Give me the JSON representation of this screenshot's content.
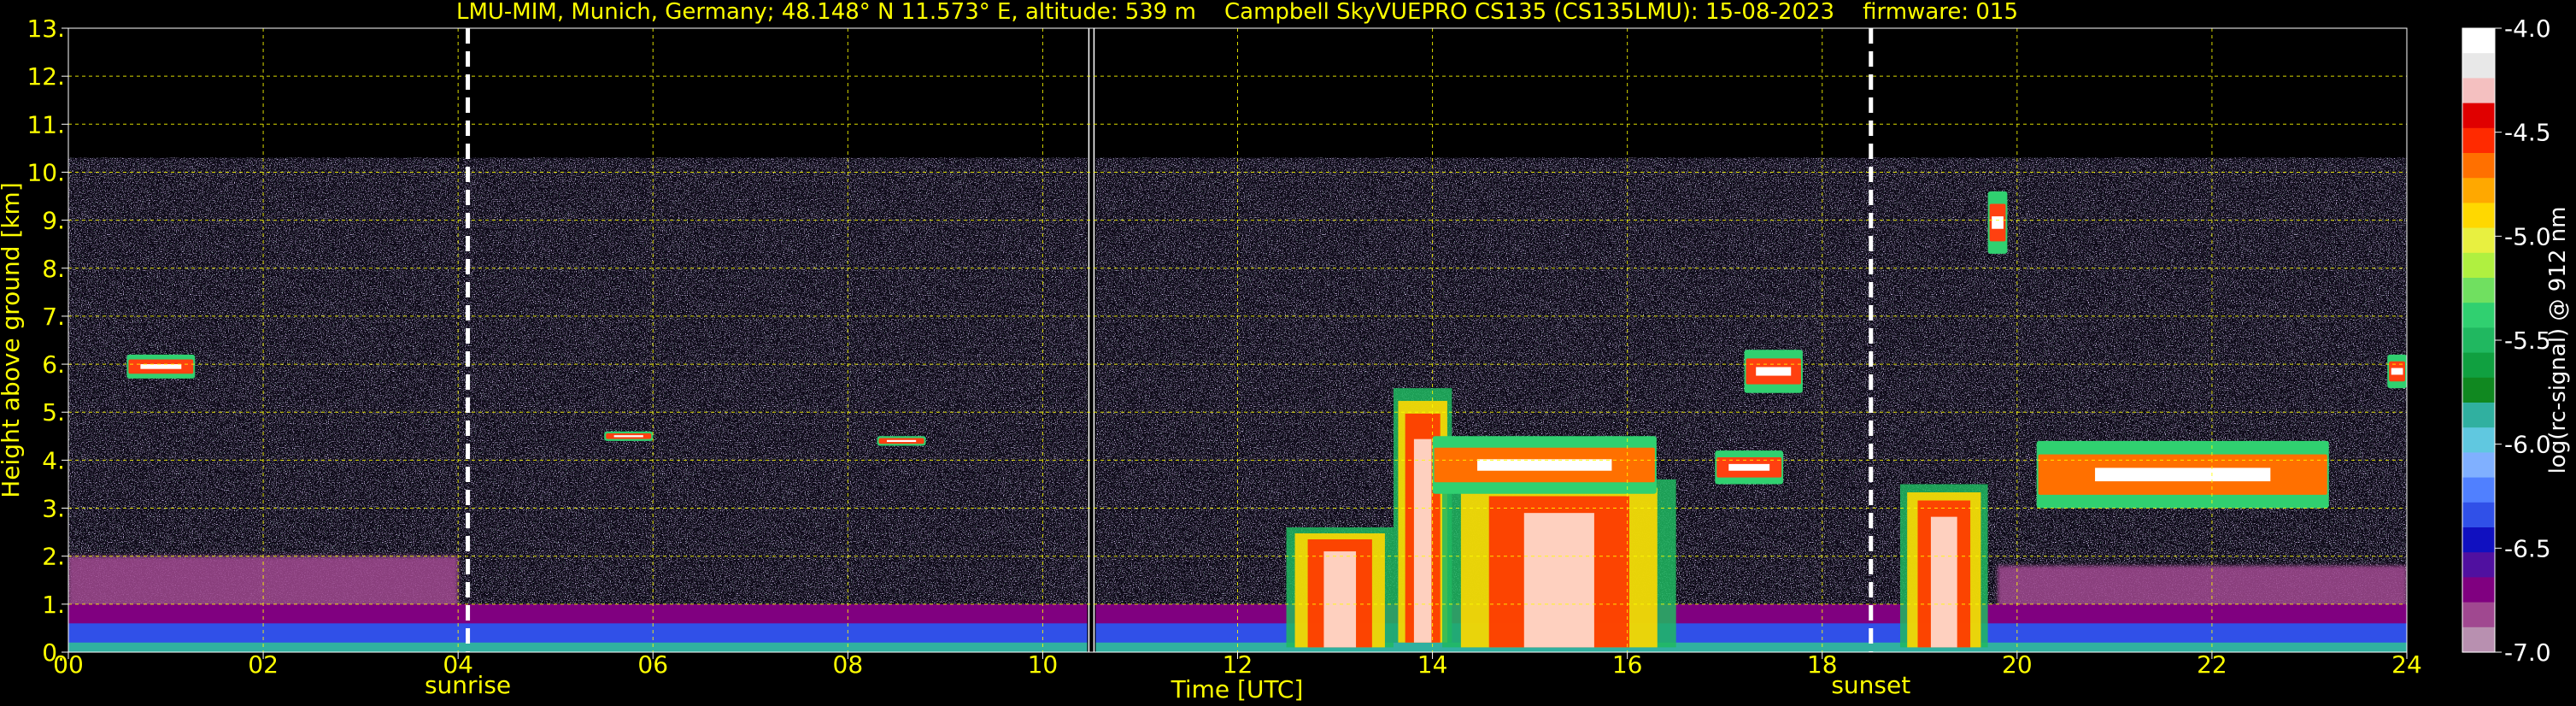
{
  "chart_data": {
    "type": "heatmap",
    "title": "LMU-MIM, Munich, Germany; 48.148° N 11.573° E, altitude: 539 m    Campbell SkyVUEPRO CS135 (CS135LMU): 15-08-2023    firmware: 015",
    "xlabel": "Time [UTC]",
    "ylabel": "Height above ground [km]",
    "xlim": [
      0,
      24
    ],
    "ylim": [
      0,
      13
    ],
    "x_ticks": [
      "00",
      "02",
      "04",
      "06",
      "08",
      "10",
      "12",
      "14",
      "16",
      "18",
      "20",
      "22",
      "24"
    ],
    "y_ticks": [
      "0.",
      "1.",
      "2.",
      "3.",
      "4.",
      "5.",
      "6.",
      "7.",
      "8.",
      "9.",
      "10.",
      "11.",
      "12.",
      "13."
    ],
    "grid": true,
    "colorbar": {
      "label": "log(rc-signal) @ 912 nm",
      "range": [
        -7.0,
        -4.0
      ],
      "ticks": [
        "-4.0",
        "-4.5",
        "-5.0",
        "-5.5",
        "-6.0",
        "-6.5",
        "-7.0"
      ],
      "colors": [
        "#ffffff",
        "#e8e8e8",
        "#f4c0c0",
        "#e00000",
        "#ff2a00",
        "#ff7000",
        "#ffa800",
        "#ffd800",
        "#e8f040",
        "#b0f040",
        "#70e060",
        "#30d070",
        "#20b860",
        "#10a040",
        "#108820",
        "#30b0a0",
        "#60c8e0",
        "#80b0ff",
        "#5080ff",
        "#3050e8",
        "#1010c0",
        "#5010a0",
        "#800080",
        "#a04890",
        "#b890b0"
      ]
    },
    "events": [
      {
        "label": "sunrise",
        "time": 4.1
      },
      {
        "label": "sunset",
        "time": 18.5
      }
    ],
    "data_gap": {
      "time": 10.5
    },
    "data_top_km": 10.3,
    "features": [
      {
        "type": "boundary_layer",
        "time_start": 0,
        "time_end": 24,
        "top_km": 1.0
      },
      {
        "type": "residual_layer",
        "time_start": 0,
        "time_end": 4.0,
        "top_km": 2.0
      },
      {
        "type": "residual_layer",
        "time_start": 19.8,
        "time_end": 24,
        "top_km": 1.8
      },
      {
        "type": "cloud",
        "time_start": 0.6,
        "time_end": 1.3,
        "base_km": 5.7,
        "top_km": 6.2
      },
      {
        "type": "cloud",
        "time_start": 5.5,
        "time_end": 6.0,
        "base_km": 4.4,
        "top_km": 4.6
      },
      {
        "type": "cloud",
        "time_start": 8.3,
        "time_end": 8.8,
        "base_km": 4.3,
        "top_km": 4.5
      },
      {
        "type": "convective_cloud",
        "time_start": 12.5,
        "time_end": 13.6,
        "base_km": 0.1,
        "top_km": 2.6
      },
      {
        "type": "convective_cloud",
        "time_start": 13.6,
        "time_end": 14.2,
        "base_km": 0.2,
        "top_km": 5.5
      },
      {
        "type": "cloud_layer",
        "time_start": 14.0,
        "time_end": 16.3,
        "base_km": 3.3,
        "top_km": 4.5
      },
      {
        "type": "convective_cloud",
        "time_start": 14.1,
        "time_end": 16.5,
        "base_km": 0.1,
        "top_km": 3.6
      },
      {
        "type": "cloud",
        "time_start": 16.9,
        "time_end": 17.6,
        "base_km": 3.5,
        "top_km": 4.2
      },
      {
        "type": "cloud",
        "time_start": 17.2,
        "time_end": 17.8,
        "base_km": 5.4,
        "top_km": 6.3
      },
      {
        "type": "convective_cloud",
        "time_start": 18.8,
        "time_end": 19.7,
        "base_km": 0.1,
        "top_km": 3.5
      },
      {
        "type": "cloud_layer",
        "time_start": 20.2,
        "time_end": 23.2,
        "base_km": 3.0,
        "top_km": 4.4
      },
      {
        "type": "cloud",
        "time_start": 19.7,
        "time_end": 19.9,
        "base_km": 8.3,
        "top_km": 9.6
      },
      {
        "type": "cloud",
        "time_start": 23.8,
        "time_end": 24,
        "base_km": 5.5,
        "top_km": 6.2
      }
    ]
  }
}
